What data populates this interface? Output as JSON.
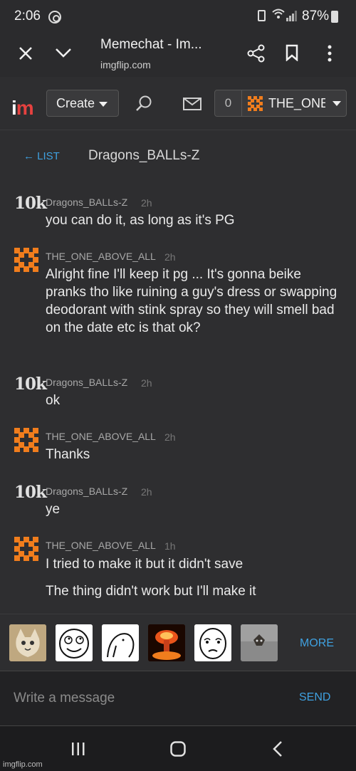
{
  "status_bar": {
    "time": "2:06",
    "battery": "87%"
  },
  "browser": {
    "title": "Memechat - Im...",
    "url": "imgflip.com"
  },
  "site_header": {
    "logo_i": "i",
    "logo_m": "m",
    "create_label": "Create",
    "notification_count": "0",
    "username": "THE_ONE_ABOVE_ALL"
  },
  "chat": {
    "list_label": "← LIST",
    "partner": "Dragons_BALLs-Z",
    "avatar_text": "10k"
  },
  "messages": [
    {
      "user": "Dragons_BALLs-Z",
      "time": "2h",
      "lines": [
        "you can do it, as long as it's PG"
      ]
    },
    {
      "user": "THE_ONE_ABOVE_ALL",
      "time": "2h",
      "lines": [
        "Alright fine I'll keep it pg ... It's gonna beike pranks tho like ruining a guy's dress or swapping deodorant with stink spray so they will smell bad on the date etc is that ok?"
      ]
    },
    {
      "user": "Dragons_BALLs-Z",
      "time": "2h",
      "lines": [
        "ok"
      ]
    },
    {
      "user": "THE_ONE_ABOVE_ALL",
      "time": "2h",
      "lines": [
        "Thanks"
      ]
    },
    {
      "user": "Dragons_BALLs-Z",
      "time": "2h",
      "lines": [
        "ye"
      ]
    },
    {
      "user": "THE_ONE_ABOVE_ALL",
      "time": "1h",
      "lines": [
        "I tried to make it but it didn't save",
        "The thing didn't work but I'll make it"
      ]
    }
  ],
  "meme_strip": {
    "more_label": "MORE",
    "memes": [
      "cat-meme-icon",
      "rage-face-meme-icon",
      "seal-meme-icon",
      "explosion-meme-icon",
      "okay-face-meme-icon",
      "ceiling-cat-meme-icon"
    ]
  },
  "composer": {
    "placeholder": "Write a message",
    "send_label": "SEND"
  },
  "watermark": "imgflip.com",
  "colors": {
    "accent_blue": "#3fa1e0",
    "brand_orange": "#f07d1d",
    "logo_red": "#e6413f",
    "background": "#2e2e30"
  }
}
